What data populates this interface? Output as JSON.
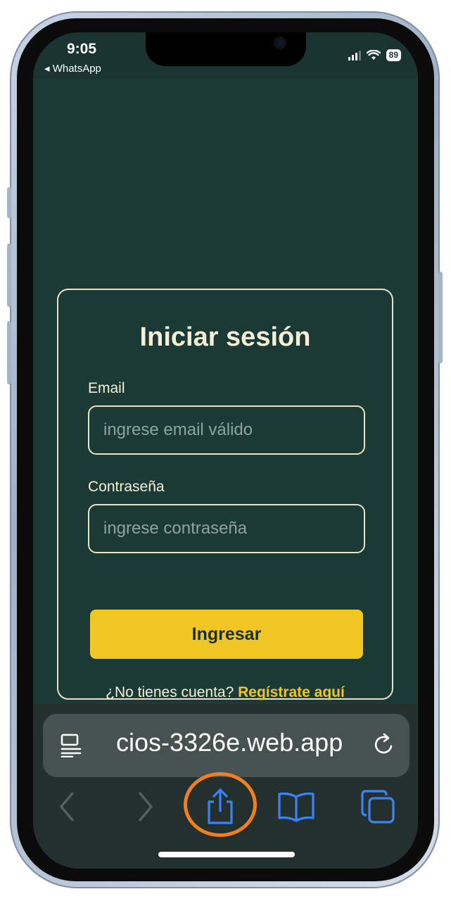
{
  "status_bar": {
    "time": "9:05",
    "back_app": "◂ WhatsApp",
    "battery": "89"
  },
  "login_card": {
    "title": "Iniciar sesión",
    "email_label": "Email",
    "email_placeholder": "ingrese email válido",
    "password_label": "Contraseña",
    "password_placeholder": "ingrese contraseña",
    "submit_label": "Ingresar",
    "no_account_text": "¿No tienes cuenta? ",
    "signup_link": "Regístrate aquí"
  },
  "browser": {
    "url": "cios-3326e.web.app",
    "toolbar": {
      "back_icon": "chevron-left-icon",
      "forward_icon": "chevron-right-icon",
      "share_icon": "share-icon",
      "bookmarks_icon": "book-icon",
      "tabs_icon": "tabs-icon"
    }
  },
  "colors": {
    "page_background": "#1b3a36",
    "accent_yellow": "#f0c722",
    "card_text": "#f6efd3",
    "annotation_orange": "#f07f22",
    "toolbar_blue": "#3b82f6"
  }
}
